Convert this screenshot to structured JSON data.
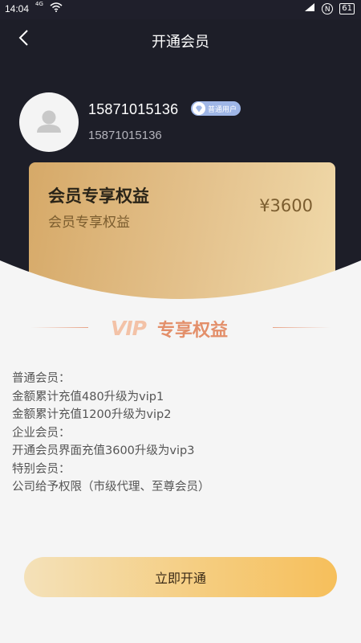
{
  "status_bar": {
    "time": "14:04",
    "network": "4G",
    "battery": "61",
    "icons": [
      "wifi-icon",
      "nfc-icon",
      "signal-icon",
      "battery-icon"
    ]
  },
  "nav": {
    "title": "开通会员",
    "back_icon": "chevron-left-icon"
  },
  "user": {
    "phone": "15871015136",
    "account": "15871015136",
    "badge": "普通用户"
  },
  "card": {
    "title": "会员专享权益",
    "subtitle": "会员专享权益",
    "price": "¥3600"
  },
  "section": {
    "logo_text": "VIP",
    "title": "专享权益"
  },
  "rules": [
    "普通会员：",
    "金额累计充值480升级为vip1",
    "金额累计充值1200升级为vip2",
    "企业会员：",
    "开通会员界面充值3600升级为vip3",
    "特别会员：",
    "公司给予权限（市级代理、至尊会员）"
  ],
  "cta": {
    "label": "立即开通"
  },
  "colors": {
    "header_bg": "#1d1e28",
    "page_bg": "#f5f5f5",
    "card_gold": "#e4c28d",
    "accent_orange": "#e38f6a",
    "cta_gold": "#f6bf5b"
  }
}
